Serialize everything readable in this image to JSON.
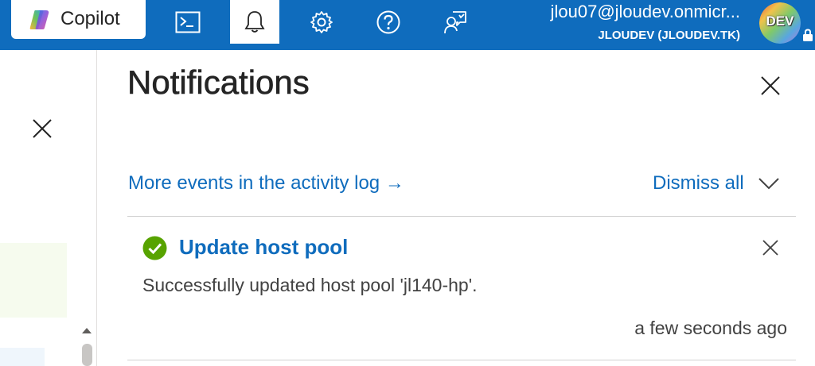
{
  "topbar": {
    "copilot_label": "Copilot",
    "icons": [
      "cloud-shell-icon",
      "bell-icon",
      "gear-icon",
      "help-icon",
      "feedback-icon"
    ],
    "active_icon": "bell-icon"
  },
  "account": {
    "email": "jlou07@jloudev.onmicr...",
    "tenant": "JLOUDEV (JLOUDEV.TK)",
    "avatar_text": "DEV"
  },
  "panel": {
    "title": "Notifications",
    "activity_link": "More events in the activity log →",
    "dismiss_all": "Dismiss all"
  },
  "notifications": [
    {
      "status": "success",
      "title": "Update host pool",
      "message": "Successfully updated host pool 'jl140-hp'.",
      "time": "a few seconds ago"
    }
  ],
  "colors": {
    "brand": "#0f6cbd",
    "success": "#57a300",
    "text": "#242424",
    "secondary_text": "#424242"
  }
}
